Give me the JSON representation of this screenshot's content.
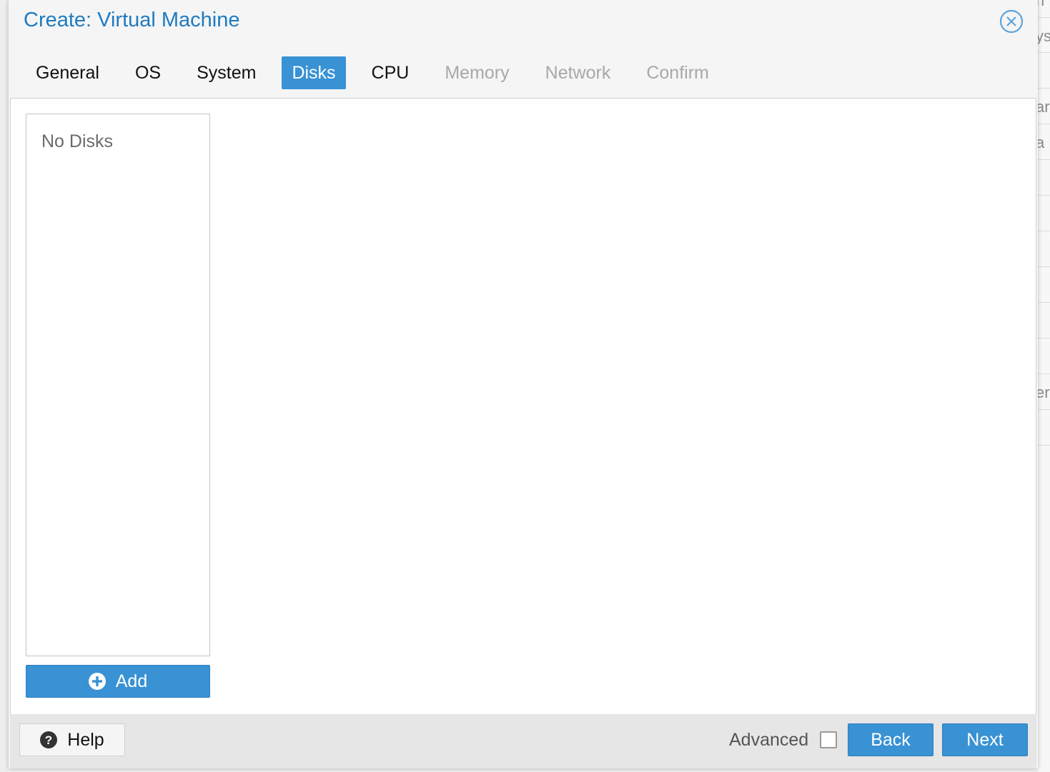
{
  "dialog": {
    "title": "Create: Virtual Machine",
    "close_icon": "close-circle-icon"
  },
  "tabs": [
    {
      "label": "General",
      "state": "enabled"
    },
    {
      "label": "OS",
      "state": "enabled"
    },
    {
      "label": "System",
      "state": "enabled"
    },
    {
      "label": "Disks",
      "state": "active"
    },
    {
      "label": "CPU",
      "state": "enabled"
    },
    {
      "label": "Memory",
      "state": "disabled"
    },
    {
      "label": "Network",
      "state": "disabled"
    },
    {
      "label": "Confirm",
      "state": "disabled"
    }
  ],
  "disks": {
    "empty_text": "No Disks",
    "add_label": "Add",
    "add_icon": "plus-circle-icon"
  },
  "footer": {
    "help_label": "Help",
    "help_icon": "question-circle-icon",
    "advanced_label": "Advanced",
    "advanced_checked": false,
    "back_label": "Back",
    "next_label": "Next"
  },
  "background_fragments": [
    "n",
    "ys",
    "ar",
    "a",
    "er"
  ],
  "colors": {
    "accent": "#3892d4",
    "title": "#1f7bc0",
    "disabled_tab": "#a8a8a8"
  }
}
